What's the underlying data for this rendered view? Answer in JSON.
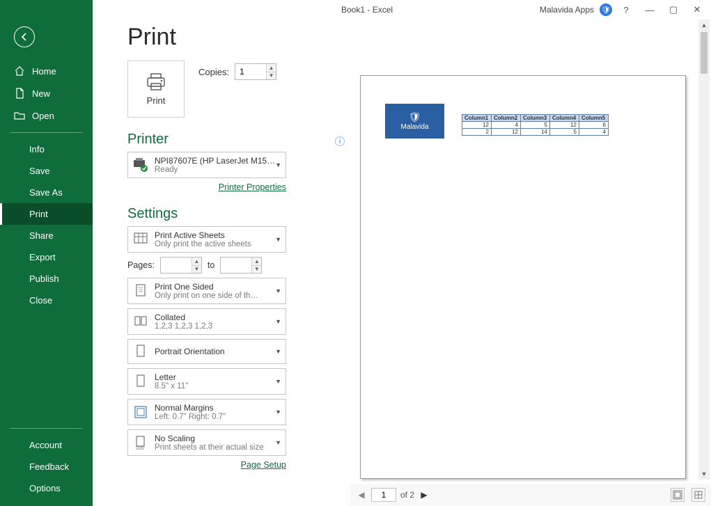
{
  "titlebar": {
    "doc": "Book1  -  Excel",
    "app": "Malavida Apps",
    "help": "?"
  },
  "sidebar": {
    "home": "Home",
    "new": "New",
    "open": "Open",
    "info": "Info",
    "save": "Save",
    "saveas": "Save As",
    "print": "Print",
    "share": "Share",
    "export": "Export",
    "publish": "Publish",
    "close": "Close",
    "account": "Account",
    "feedback": "Feedback",
    "options": "Options"
  },
  "panel": {
    "title": "Print",
    "print_label": "Print",
    "copies_label": "Copies:",
    "copies_value": "1",
    "printer_h": "Printer",
    "printer_name": "NPI87607E (HP LaserJet M15…",
    "printer_status": "Ready",
    "printer_props": "Printer Properties",
    "settings_h": "Settings",
    "s_active_t": "Print Active Sheets",
    "s_active_d": "Only print the active sheets",
    "pages_lbl": "Pages:",
    "pages_to": "to",
    "s_oneside_t": "Print One Sided",
    "s_oneside_d": "Only print on one side of th…",
    "s_coll_t": "Collated",
    "s_coll_d": "1,2,3    1,2,3    1,2,3",
    "s_orient_t": "Portrait Orientation",
    "s_letter_t": "Letter",
    "s_letter_d": "8.5\" x 11\"",
    "s_marg_t": "Normal Margins",
    "s_marg_d": "Left:  0.7\"    Right:  0.7\"",
    "s_scale_t": "No Scaling",
    "s_scale_d": "Print sheets at their actual size",
    "scale_num": "100",
    "page_setup": "Page Setup"
  },
  "preview": {
    "logo_text": "Malavida",
    "headers": [
      "Column1",
      "Column2",
      "Column3",
      "Column4",
      "Column5"
    ],
    "rows": [
      [
        12,
        4,
        5,
        12,
        6
      ],
      [
        2,
        12,
        14,
        5,
        4
      ]
    ],
    "page_current": "1",
    "page_total": "of 2"
  }
}
